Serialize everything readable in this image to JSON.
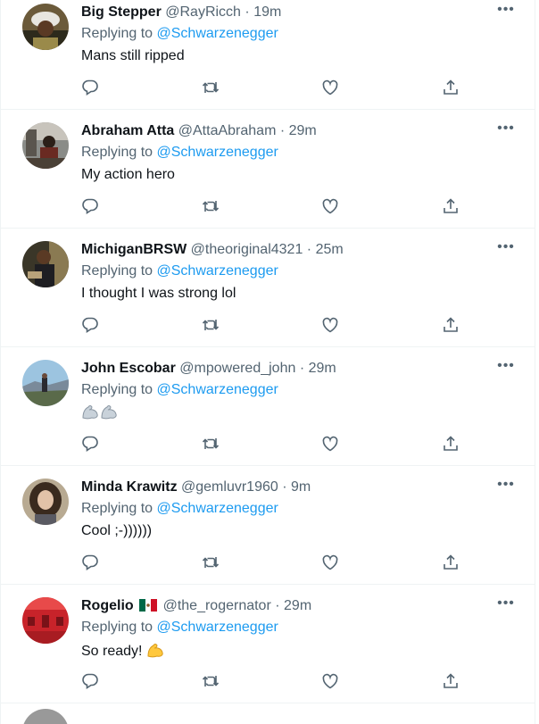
{
  "replying_label": "Replying to",
  "mention": "@Schwarzenegger",
  "separator": "·",
  "more_label": "•••",
  "tweets": [
    {
      "name": "Big Stepper",
      "handle": "@RayRicch",
      "time": "19m",
      "text": "Mans still ripped",
      "avatar": "avatar-big-stepper"
    },
    {
      "name": "Abraham Atta",
      "handle": "@AttaAbraham",
      "time": "29m",
      "text": "My action hero",
      "avatar": "avatar-abraham"
    },
    {
      "name": "MichiganBRSW",
      "handle": "@theoriginal4321",
      "time": "25m",
      "text": "I thought I was strong lol",
      "avatar": "avatar-michigan"
    },
    {
      "name": "John Escobar",
      "handle": "@mpowered_john",
      "time": "29m",
      "text": "",
      "avatar": "avatar-john",
      "emoji": [
        "flexed-biceps-metal",
        "flexed-biceps-metal"
      ]
    },
    {
      "name": "Minda Krawitz",
      "handle": "@gemluvr1960",
      "time": "9m",
      "text": "Cool ;-))))))",
      "avatar": "avatar-minda"
    },
    {
      "name": "Rogelio",
      "handle": "@the_rogernator",
      "time": "29m",
      "text": "So ready!",
      "avatar": "avatar-rogelio",
      "flag": "mexico-flag",
      "emoji": [
        "flexed-biceps"
      ]
    }
  ],
  "colors": {
    "accent": "#1d9bf0",
    "secondary_text": "#536471",
    "divider": "#eff3f4"
  }
}
